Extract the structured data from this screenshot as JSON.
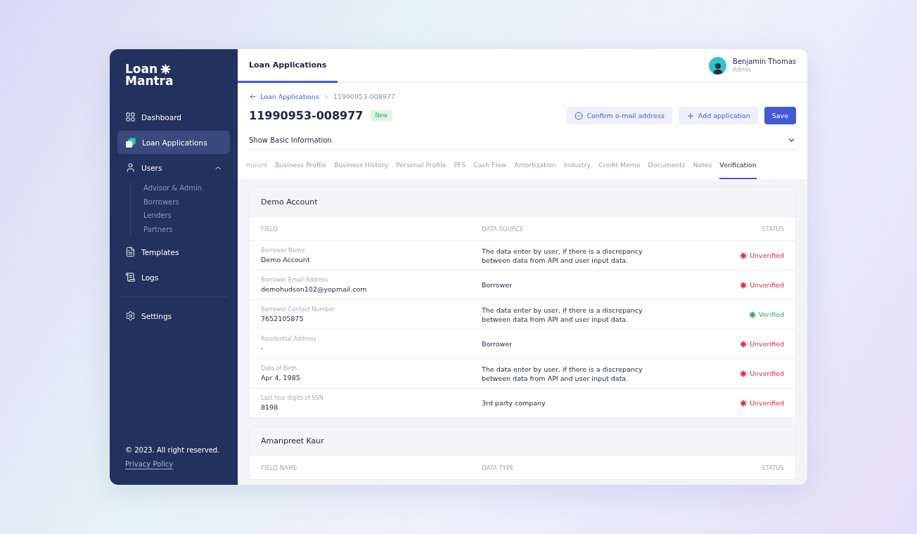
{
  "brand": {
    "line1": "Loan",
    "line2": "Mantra"
  },
  "sidebar": {
    "items": [
      {
        "label": "Dashboard",
        "selected": false
      },
      {
        "label": "Loan Applications",
        "selected": true
      },
      {
        "label": "Users",
        "selected": false,
        "expanded": true,
        "children": [
          {
            "label": "Advisor & Admin"
          },
          {
            "label": "Borrowers"
          },
          {
            "label": "Lenders"
          },
          {
            "label": "Partners"
          }
        ]
      },
      {
        "label": "Templates",
        "selected": false
      },
      {
        "label": "Logs",
        "selected": false
      }
    ],
    "bottom_items": [
      {
        "label": "Settings",
        "selected": false
      }
    ],
    "footer": {
      "copyright": "© 2023. All right reserved.",
      "link": "Privacy Policy"
    }
  },
  "header": {
    "tab": "Loan Applications",
    "user": {
      "name": "Benjamin Thomas",
      "role": "Admin"
    }
  },
  "breadcrumb": {
    "back": "Loan Applications",
    "current": "11990953-008977"
  },
  "title": "11990953-008977",
  "badge": "New",
  "actions": [
    {
      "label": "Confirm e-mail address",
      "kind": "secondary"
    },
    {
      "label": "Add application",
      "kind": "secondary"
    },
    {
      "label": "Save",
      "kind": "primary"
    }
  ],
  "basic_info": {
    "label": "Show Basic Information",
    "expanded": false
  },
  "tabs": [
    {
      "label": "mount",
      "selected": false,
      "faded": true
    },
    {
      "label": "Business Profile",
      "selected": false
    },
    {
      "label": "Business History",
      "selected": false
    },
    {
      "label": "Personal Profile",
      "selected": false
    },
    {
      "label": "PFS",
      "selected": false
    },
    {
      "label": "Cash Flow",
      "selected": false
    },
    {
      "label": "Amortization",
      "selected": false
    },
    {
      "label": "Industry",
      "selected": false
    },
    {
      "label": "Credit Memo",
      "selected": false
    },
    {
      "label": "Documents",
      "selected": false
    },
    {
      "label": "Notes",
      "selected": false
    },
    {
      "label": "Verification",
      "selected": true
    }
  ],
  "sections": [
    {
      "title": "Demo Account",
      "columns": [
        "FIELD",
        "DATA SOURCE",
        "STATUS"
      ],
      "rows": [
        {
          "label": "Borrower Name",
          "value": "Demo Account",
          "source": "The data enter by user, if there is a discrepancy between data from API and user input data.",
          "status": "Unverified",
          "verified": false
        },
        {
          "label": "Borrower Email Address",
          "value": "demohudson102@yopmail.com",
          "source": "Borrower",
          "status": "Unverified",
          "verified": false
        },
        {
          "label": "Borrower Contact Number",
          "value": "7652105875",
          "source": "The data enter by user, if there is a discrepancy between data from API and user input data.",
          "status": "Verified",
          "verified": true
        },
        {
          "label": "Residential Address",
          "value": "-",
          "source": "Borrower",
          "status": "Unverified",
          "verified": false
        },
        {
          "label": "Date of Birth",
          "value": "Apr 4, 1985",
          "source": "The data enter by user, if there is a discrepancy between data from API and user input data.",
          "status": "Unverified",
          "verified": false
        },
        {
          "label": "Last four digits of SSN",
          "value": "8198",
          "source": "3rd party company",
          "status": "Unverified",
          "verified": false
        }
      ]
    },
    {
      "title": "Amanpreet Kaur",
      "columns": [
        "FIELD NAME",
        "DATA TYPE",
        "STATUS"
      ]
    }
  ]
}
